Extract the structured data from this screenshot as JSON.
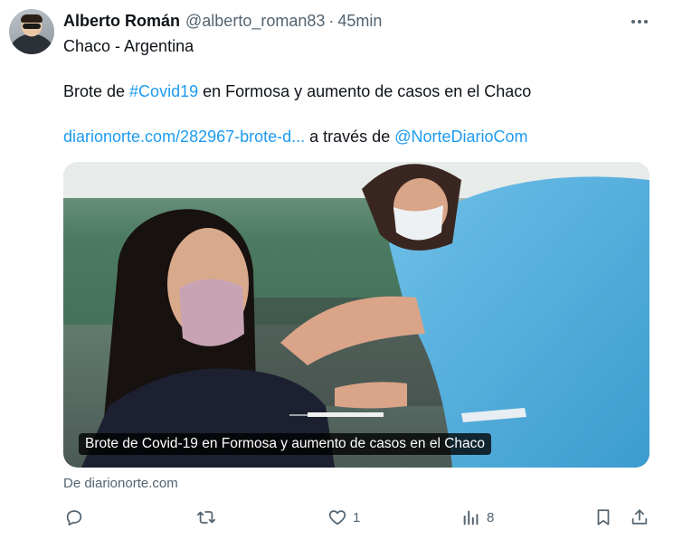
{
  "tweet": {
    "author_name": "Alberto Román",
    "handle": "@alberto_roman83",
    "separator": "·",
    "time": "45min",
    "line1": "Chaco - Argentina",
    "line2_prefix": "Brote de ",
    "hashtag": "#Covid19",
    "line2_suffix": " en Formosa y aumento de casos en el Chaco",
    "url_text": "diarionorte.com/282967-brote-d...",
    "via_text": " a través de ",
    "mention": "@NorteDiarioCom"
  },
  "card": {
    "caption": "Brote de Covid-19 en Formosa y aumento de casos en el Chaco",
    "source": "De diarionorte.com"
  },
  "actions": {
    "reply_count": "",
    "retweet_count": "",
    "like_count": "1",
    "views_count": "8"
  },
  "icons": {
    "more": "more-horizontal-icon",
    "reply": "reply-icon",
    "retweet": "retweet-icon",
    "like": "heart-icon",
    "views": "views-icon",
    "bookmark": "bookmark-icon",
    "share": "share-icon"
  },
  "colors": {
    "text": "#0f1419",
    "secondary": "#536471",
    "link": "#1d9bf0"
  }
}
